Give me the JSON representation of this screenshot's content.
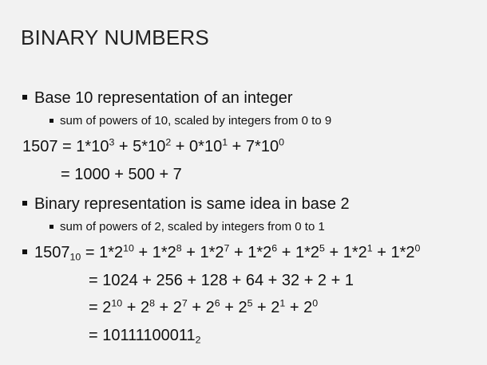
{
  "slide": {
    "title": "BINARY NUMBERS",
    "bullet1": "Base 10 representation of an integer",
    "sub1": "sum of powers of 10, scaled by integers from 0 to 9",
    "eq_dec": {
      "lhs": "1507",
      "terms": [
        {
          "coef": "1",
          "base": "10",
          "exp": "3"
        },
        {
          "coef": "5",
          "base": "10",
          "exp": "2"
        },
        {
          "coef": "0",
          "base": "10",
          "exp": "1"
        },
        {
          "coef": "7",
          "base": "10",
          "exp": "0"
        }
      ],
      "line2": "= 1000 + 500 + 7"
    },
    "bullet2": "Binary representation is same idea in base 2",
    "sub2": "sum of powers of 2, scaled by integers from 0 to 1",
    "eq_bin": {
      "lhs": "1507",
      "lhs_sub": "10",
      "terms": [
        {
          "coef": "1",
          "base": "2",
          "exp": "10"
        },
        {
          "coef": "1",
          "base": "2",
          "exp": "8"
        },
        {
          "coef": "1",
          "base": "2",
          "exp": "7"
        },
        {
          "coef": "1",
          "base": "2",
          "exp": "6"
        },
        {
          "coef": "1",
          "base": "2",
          "exp": "5"
        },
        {
          "coef": "1",
          "base": "2",
          "exp": "1"
        },
        {
          "coef": "1",
          "base": "2",
          "exp": "0"
        }
      ],
      "line2": "= 1024 + 256 + 128 + 64 + 32 + 2 + 1",
      "powers": [
        {
          "base": "2",
          "exp": "10"
        },
        {
          "base": "2",
          "exp": "8"
        },
        {
          "base": "2",
          "exp": "7"
        },
        {
          "base": "2",
          "exp": "6"
        },
        {
          "base": "2",
          "exp": "5"
        },
        {
          "base": "2",
          "exp": "1"
        },
        {
          "base": "2",
          "exp": "0"
        }
      ],
      "result": "10111100011",
      "result_sub": "2"
    }
  }
}
